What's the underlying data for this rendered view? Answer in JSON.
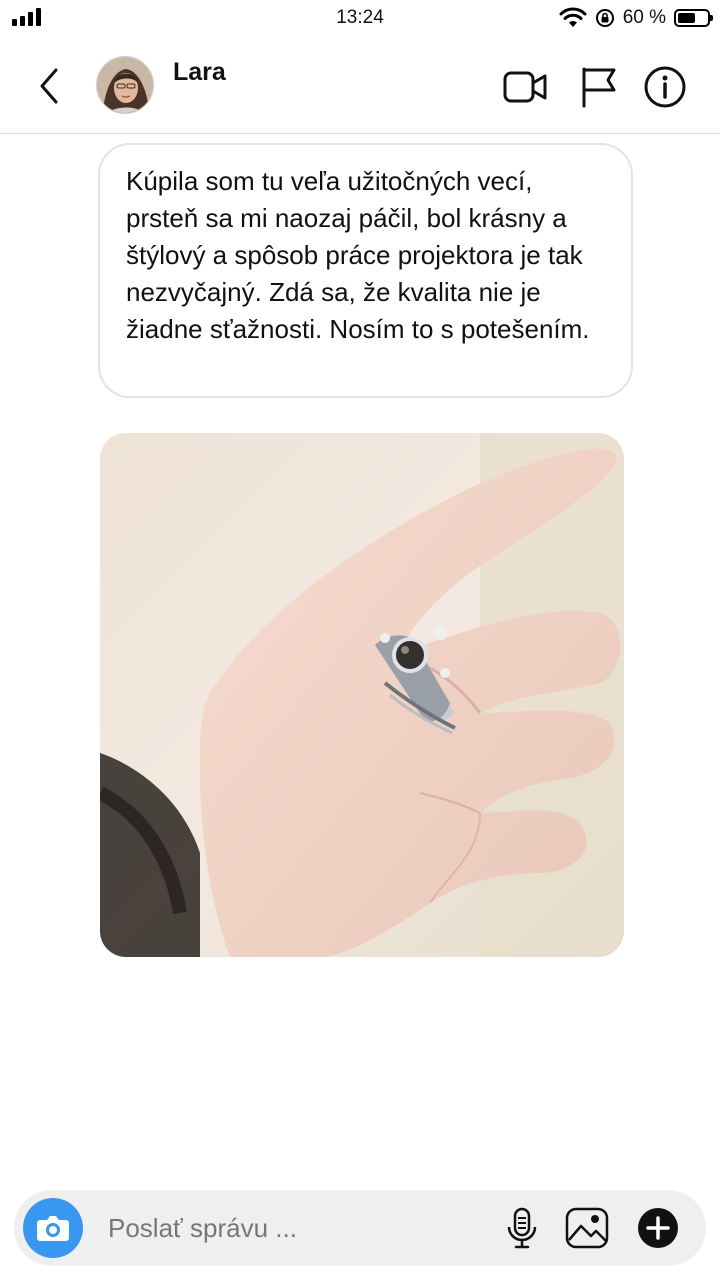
{
  "status_bar": {
    "time": "13:24",
    "battery_percent": "60 %",
    "battery_level": 0.6,
    "signal_icon": "signal-bars-icon",
    "wifi_icon": "wifi-icon",
    "rotation_lock_icon": "rotation-lock-icon"
  },
  "header": {
    "contact_name": "Lara",
    "back_icon": "chevron-left-icon",
    "video_icon": "video-camera-icon",
    "flag_icon": "flag-icon",
    "info_icon": "info-icon"
  },
  "conversation": {
    "messages": [
      {
        "type": "text",
        "text": "Kúpila som tu veľa užitočných vecí, prsteň sa mi naozaj páčil, bol krásny a štýlový a spôsob práce projektora je tak nezvyčajný. Zdá sa, že kvalita nie je žiadne sťažnosti. Nosím to s potešením."
      },
      {
        "type": "image",
        "subject": "hand wearing silver ring"
      }
    ]
  },
  "composer": {
    "placeholder": "Poslať správu ...",
    "value": "",
    "camera_icon": "camera-icon",
    "mic_icon": "microphone-icon",
    "gallery_icon": "image-gallery-icon",
    "plus_icon": "plus-circle-icon"
  },
  "colors": {
    "accent": "#3897f0",
    "composer_bg": "#efefef",
    "bubble_border": "#e3e3e3"
  }
}
